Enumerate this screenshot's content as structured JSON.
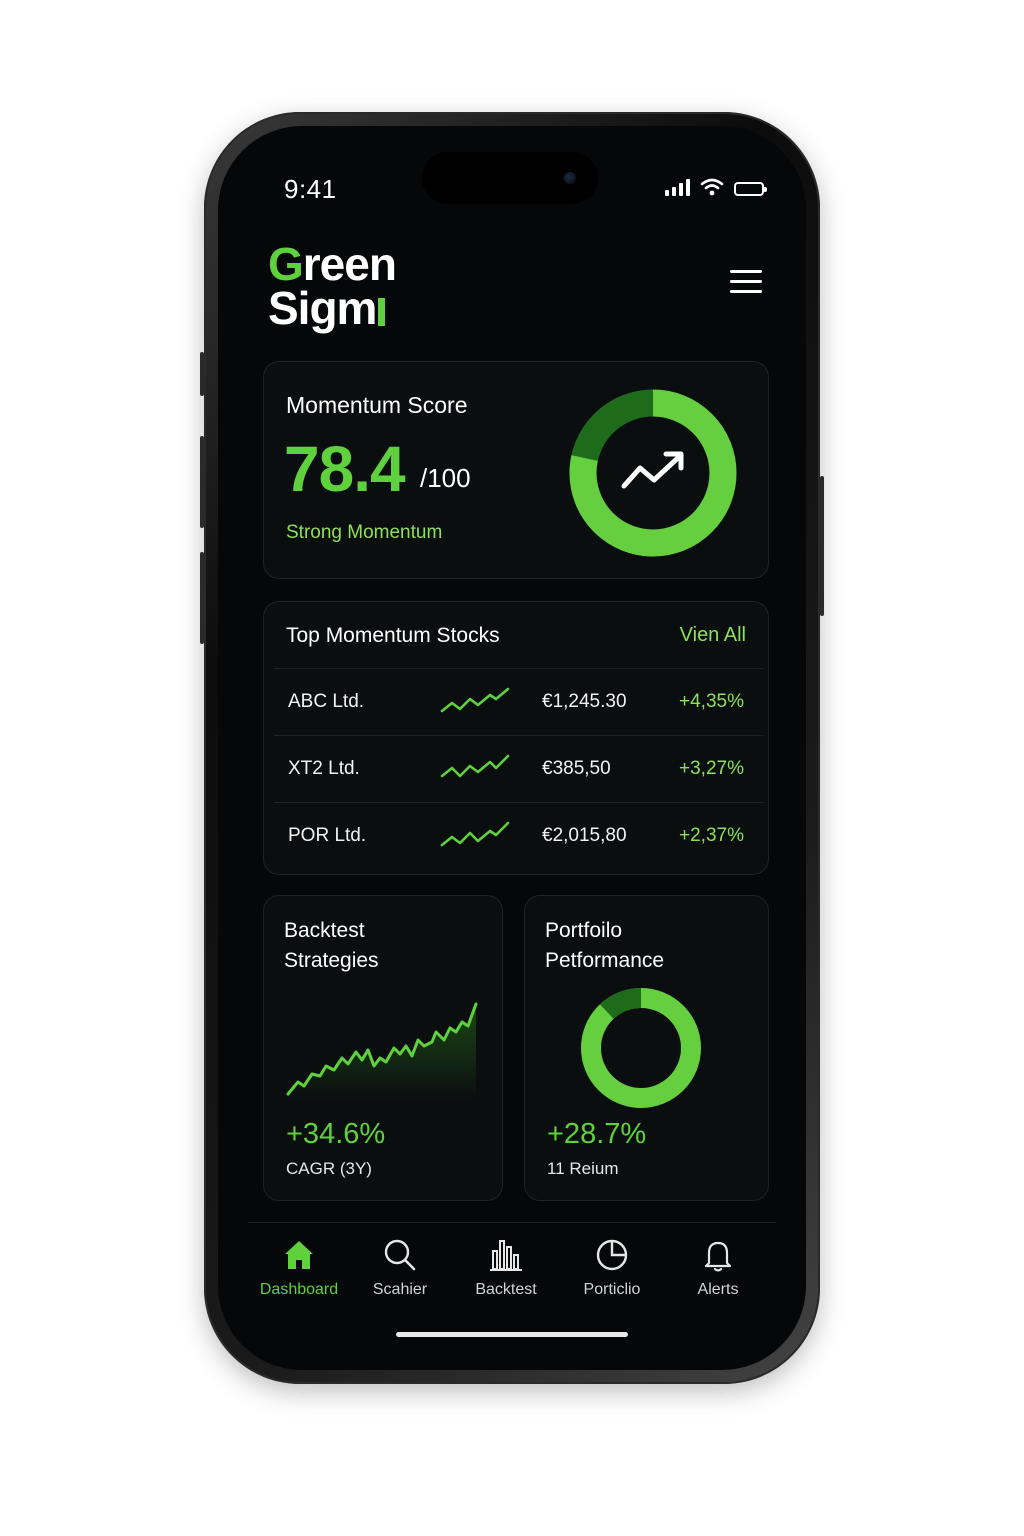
{
  "status_bar": {
    "time": "9:41"
  },
  "app": {
    "logo_line1_lead": "G",
    "logo_line1_rest": "reen",
    "logo_line2": "Sigm"
  },
  "momentum": {
    "title": "Momentum Score",
    "score": "78.4",
    "max": "/100",
    "status": "Strong Momentum",
    "score_fraction": 0.784
  },
  "top_stocks": {
    "title": "Top Momentum Stocks",
    "view_all": "Vien All",
    "rows": [
      {
        "name": "ABC Ltd.",
        "price": "€1,245.30",
        "change": "+4,35%"
      },
      {
        "name": "XT2 Ltd.",
        "price": "€385,50",
        "change": "+3,27%"
      },
      {
        "name": "POR Ltd.",
        "price": "€2,015,80",
        "change": "+2,37%"
      }
    ]
  },
  "backtest": {
    "title_line1": "Backtest",
    "title_line2": "Strategies",
    "value": "+34.6%",
    "sub": "CAGR (3Y)"
  },
  "portfolio": {
    "title_line1": "Portfoilo",
    "title_line2": "Petformance",
    "value": "+28.7%",
    "sub": "11 Reium",
    "dark_fraction": 0.12
  },
  "tabs": [
    {
      "label": "Dashboard",
      "icon": "home-icon",
      "active": true
    },
    {
      "label": "Scahier",
      "icon": "search-icon",
      "active": false
    },
    {
      "label": "Backtest",
      "icon": "bar-chart-icon",
      "active": false
    },
    {
      "label": "Porticlio",
      "icon": "pie-chart-icon",
      "active": false
    },
    {
      "label": "Alerts",
      "icon": "bell-icon",
      "active": false
    }
  ],
  "colors": {
    "accent": "#5fd13d",
    "accent_dark": "#1f6b1c",
    "accent_text": "#8de05a",
    "background": "#050708"
  }
}
